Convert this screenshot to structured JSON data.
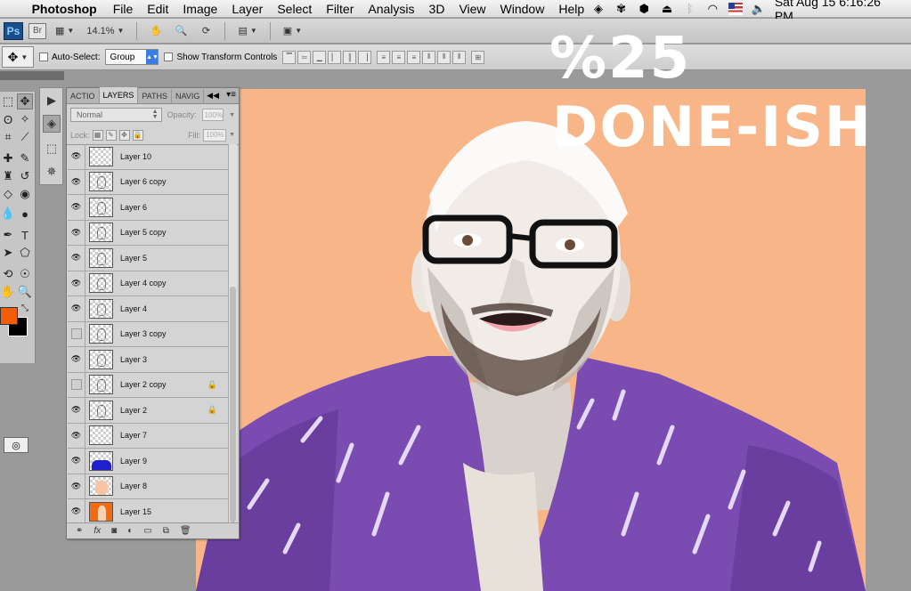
{
  "menubar": {
    "app_name": "Photoshop",
    "menus": [
      "File",
      "Edit",
      "Image",
      "Layer",
      "Select",
      "Filter",
      "Analysis",
      "3D",
      "View",
      "Window",
      "Help"
    ],
    "datetime": "Sat Aug 15  6:16:26 PM"
  },
  "appbar": {
    "ps_label": "Ps",
    "br_label": "Br",
    "zoom": "14.1%"
  },
  "options": {
    "auto_select_label": "Auto-Select:",
    "auto_select_value": "Group",
    "transform_label": "Show Transform Controls"
  },
  "overlay": {
    "line1": "%25",
    "line2": "DONE-ISH"
  },
  "layers_panel": {
    "tabs": [
      "ACTIO",
      "LAYERS",
      "PATHS",
      "NAVIG"
    ],
    "blend_mode": "Normal",
    "opacity_label": "Opacity:",
    "opacity_value": "100%",
    "lock_label": "Lock:",
    "fill_label": "Fill:",
    "fill_value": "100%",
    "layers": [
      {
        "name": "Layer 10",
        "visible": true,
        "locked": false,
        "thumb": "empty"
      },
      {
        "name": "Layer 6 copy",
        "visible": true,
        "locked": false,
        "thumb": "sketch"
      },
      {
        "name": "Layer 6",
        "visible": true,
        "locked": false,
        "thumb": "sketch"
      },
      {
        "name": "Layer 5 copy",
        "visible": true,
        "locked": false,
        "thumb": "sketch"
      },
      {
        "name": "Layer 5",
        "visible": true,
        "locked": false,
        "thumb": "sketch"
      },
      {
        "name": "Layer 4 copy",
        "visible": true,
        "locked": false,
        "thumb": "sketch"
      },
      {
        "name": "Layer 4",
        "visible": true,
        "locked": false,
        "thumb": "sketch"
      },
      {
        "name": "Layer 3 copy",
        "visible": false,
        "locked": false,
        "thumb": "sketch"
      },
      {
        "name": "Layer 3",
        "visible": true,
        "locked": false,
        "thumb": "sketch"
      },
      {
        "name": "Layer 2 copy",
        "visible": false,
        "locked": true,
        "thumb": "sketch"
      },
      {
        "name": "Layer 2",
        "visible": true,
        "locked": true,
        "thumb": "sketch"
      },
      {
        "name": "Layer 7",
        "visible": true,
        "locked": false,
        "thumb": "empty"
      },
      {
        "name": "Layer 9",
        "visible": true,
        "locked": false,
        "thumb": "blue"
      },
      {
        "name": "Layer 8",
        "visible": true,
        "locked": false,
        "thumb": "peach"
      },
      {
        "name": "Layer 15",
        "visible": true,
        "locked": false,
        "thumb": "orange"
      }
    ]
  },
  "colors": {
    "foreground": "#f25d07",
    "background": "#000000",
    "canvas": "#f8b587"
  }
}
